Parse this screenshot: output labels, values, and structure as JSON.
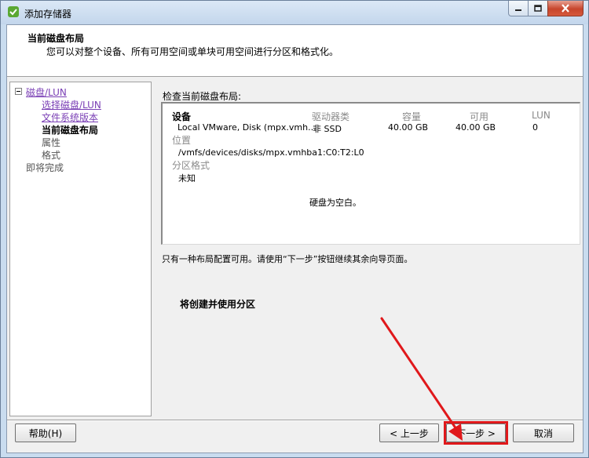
{
  "window": {
    "title": "添加存储器",
    "controls": [
      "minimize",
      "maximize",
      "close"
    ]
  },
  "header": {
    "title": "当前磁盘布局",
    "description": "您可以对整个设备、所有可用空间或单块可用空间进行分区和格式化。"
  },
  "nav": {
    "items": [
      {
        "label": "磁盘/LUN",
        "state": "link"
      },
      {
        "label": "选择磁盘/LUN",
        "state": "link"
      },
      {
        "label": "文件系统版本",
        "state": "link"
      },
      {
        "label": "当前磁盘布局",
        "state": "current"
      },
      {
        "label": "属性",
        "state": "plain"
      },
      {
        "label": "格式",
        "state": "plain"
      },
      {
        "label": "即将完成",
        "state": "plain"
      }
    ]
  },
  "layout": {
    "section_label": "检查当前磁盘布局:",
    "columns": {
      "device": "设备",
      "drive_type": "驱动器类",
      "capacity": "容量",
      "available": "可用",
      "lun": "LUN"
    },
    "row": {
      "device": "Local VMware, Disk (mpx.vmh...",
      "drive_type": "非 SSD",
      "capacity": "40.00 GB",
      "available": "40.00 GB",
      "lun": "0"
    },
    "location_label": "位置",
    "location_value": "/vmfs/devices/disks/mpx.vmhba1:C0:T2:L0",
    "partition_format_label": "分区格式",
    "partition_format_value": "未知",
    "empty_message": "硬盘为空白。"
  },
  "info_line": "只有一种布局配置可用。请使用“下一步”按钮继续其余向导页面。",
  "partition_note": "将创建并使用分区",
  "buttons": {
    "help": "帮助(H)",
    "back": "< 上一步",
    "next": "下一步 >",
    "cancel": "取消"
  },
  "colors": {
    "annotation": "#e0181b",
    "link": "#7a3fb5"
  }
}
